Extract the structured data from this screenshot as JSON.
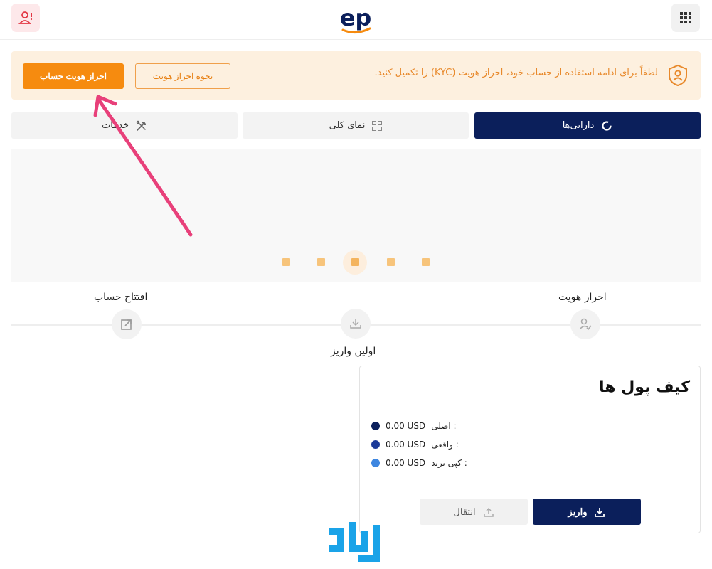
{
  "header": {
    "user_icon": "user-alert-icon",
    "menu_icon": "apps-grid-icon",
    "logo_text": "ep",
    "colors": {
      "logo_blue": "#0b1f5b",
      "logo_orange": "#f68b0f",
      "user_badge": "#e23744"
    }
  },
  "kyc_banner": {
    "message": "لطفاً برای ادامه استفاده از حساب خود، احراز هویت (KYC) را تکمیل کنید.",
    "how_to_label": "نحوه احراز هویت",
    "verify_label": "احراز هویت حساب",
    "icon": "shield-user-icon",
    "colors": {
      "background": "#fdf0df",
      "accent": "#f68b0f"
    }
  },
  "tabs": [
    {
      "label": "دارایی‌ها",
      "icon": "donut-icon",
      "active": true
    },
    {
      "label": "نمای کلی",
      "icon": "grid-icon",
      "active": false
    },
    {
      "label": "خدمات",
      "icon": "tools-icon",
      "active": false
    }
  ],
  "steps": {
    "verify_label": "احراز هویت",
    "first_deposit_label": "اولین واریز",
    "open_account_label": "افتتاح حساب"
  },
  "wallet": {
    "title": "کیف پول ها",
    "balances": [
      {
        "amount": "0.00 USD",
        "label": ": اصلی",
        "color": "#0b1f5b"
      },
      {
        "amount": "0.00 USD",
        "label": ": واقعی",
        "color": "#1b3a99"
      },
      {
        "amount": "0.00 USD",
        "label": ": کپی ترید",
        "color": "#3d86e0"
      }
    ],
    "deposit_label": "واریز",
    "transfer_label": "انتقال"
  },
  "annotation": {
    "arrow_color": "#e8407a"
  },
  "watermark": {
    "icon": "brand-watermark-icon",
    "color": "#1aa3e8"
  }
}
